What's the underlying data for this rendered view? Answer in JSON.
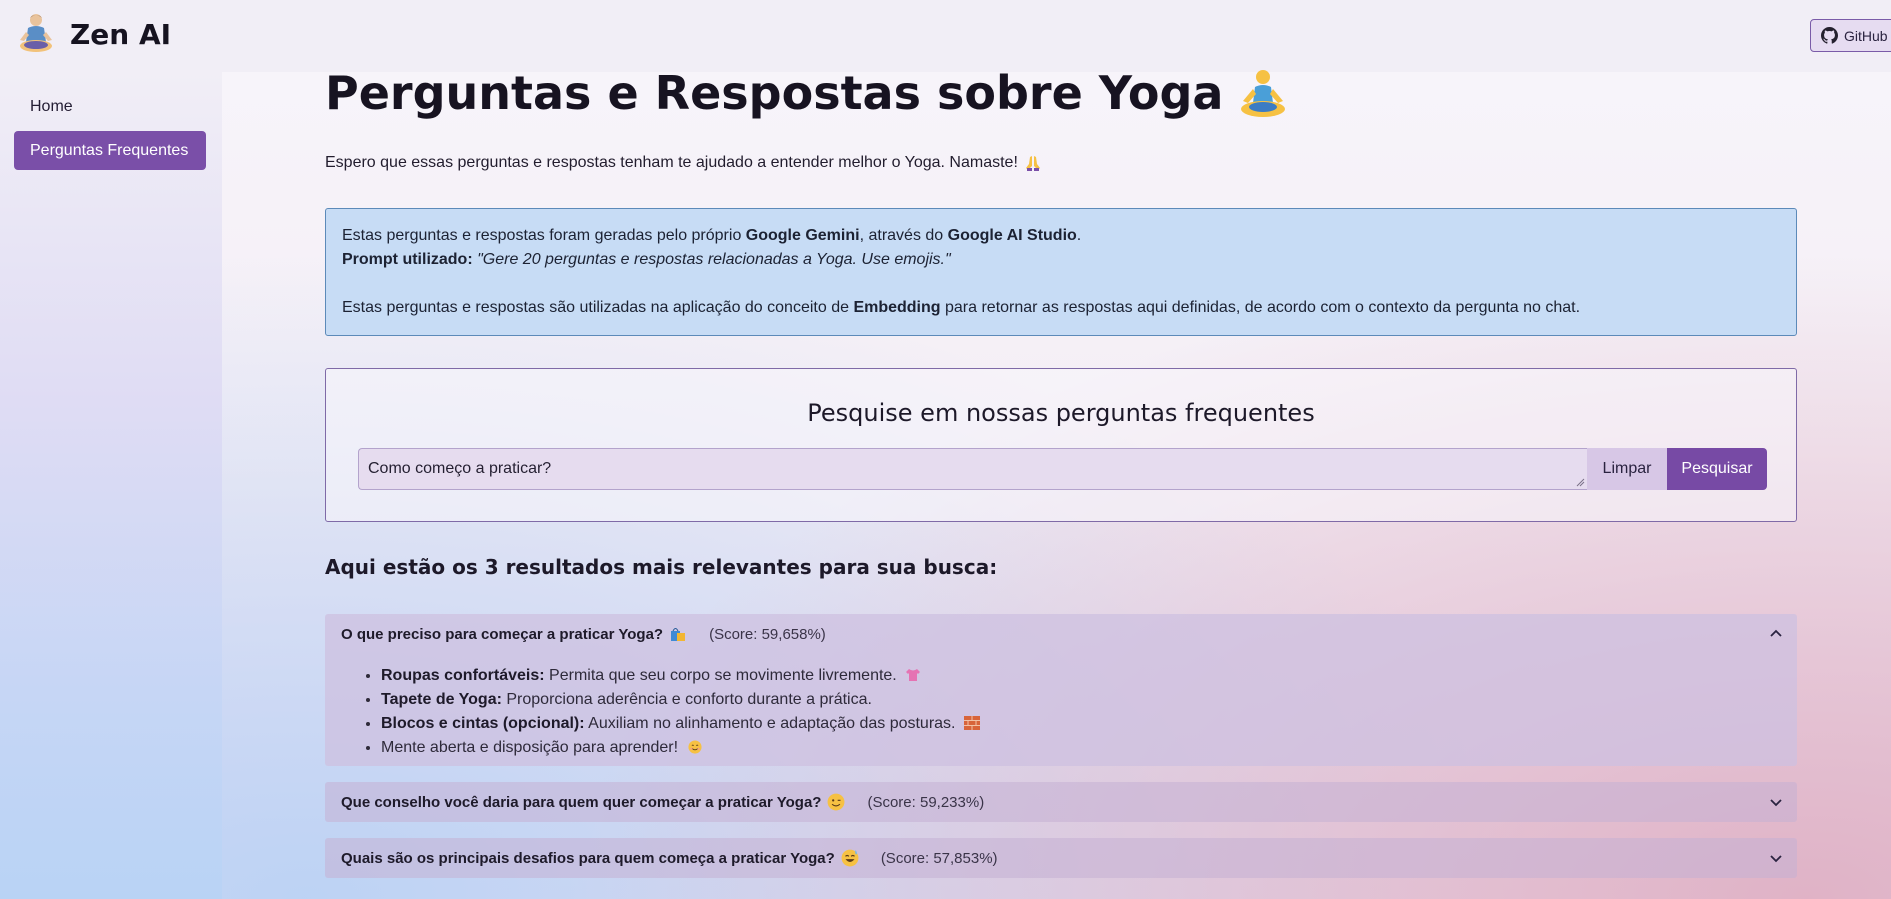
{
  "header": {
    "brand_title": "Zen AI",
    "github_label": "GitHub"
  },
  "sidebar": {
    "items": [
      {
        "label": "Home",
        "active": false
      },
      {
        "label": "Perguntas Frequentes",
        "active": true
      }
    ]
  },
  "main": {
    "title": "Perguntas e Respostas sobre Yoga",
    "intro": "Espero que essas perguntas e respostas tenham te ajudado a entender melhor o Yoga. Namaste!",
    "info": {
      "line1_a": "Estas perguntas e respostas foram geradas pelo próprio ",
      "line1_b": "Google Gemini",
      "line1_c": ", através do ",
      "line1_d": "Google AI Studio",
      "line1_e": ".",
      "prompt_label": "Prompt utilizado:",
      "prompt_text": "\"Gere 20 perguntas e respostas relacionadas a Yoga. Use emojis.\"",
      "line3_a": "Estas perguntas e respostas são utilizadas na aplicação do conceito de ",
      "line3_b": "Embedding",
      "line3_c": " para retornar as respostas aqui definidas, de acordo com o contexto da pergunta no chat."
    },
    "search": {
      "heading": "Pesquise em nossas perguntas frequentes",
      "value": "Como começo a praticar?",
      "clear_label": "Limpar",
      "search_label": "Pesquisar"
    },
    "results_heading": "Aqui estão os 3 resultados mais relevantes para sua busca:",
    "results": [
      {
        "question": "O que preciso para começar a praticar Yoga?",
        "emoji": "shopping-bags-icon",
        "score": "(Score: 59,658%)",
        "expanded": true,
        "items": [
          {
            "bold": "Roupas confortáveis:",
            "text": " Permita que seu corpo se movimente livremente."
          },
          {
            "bold": "Tapete de Yoga:",
            "text": " Proporciona aderência e conforto durante a prática."
          },
          {
            "bold": "Blocos e cintas (opcional):",
            "text": " Auxiliam no alinhamento e adaptação das posturas."
          },
          {
            "bold": "",
            "text": "Mente aberta e disposição para aprender!"
          }
        ]
      },
      {
        "question": "Que conselho você daria para quem quer começar a praticar Yoga?",
        "emoji": "wink-face-icon",
        "score": "(Score: 59,233%)",
        "expanded": false
      },
      {
        "question": "Quais são os principais desafios para quem começa a praticar Yoga?",
        "emoji": "sweat-smile-icon",
        "score": "(Score: 57,853%)",
        "expanded": false
      }
    ]
  },
  "colors": {
    "accent": "#7a4fa8",
    "info_bg": "#c7dcf5",
    "info_border": "#5c8ab9"
  }
}
